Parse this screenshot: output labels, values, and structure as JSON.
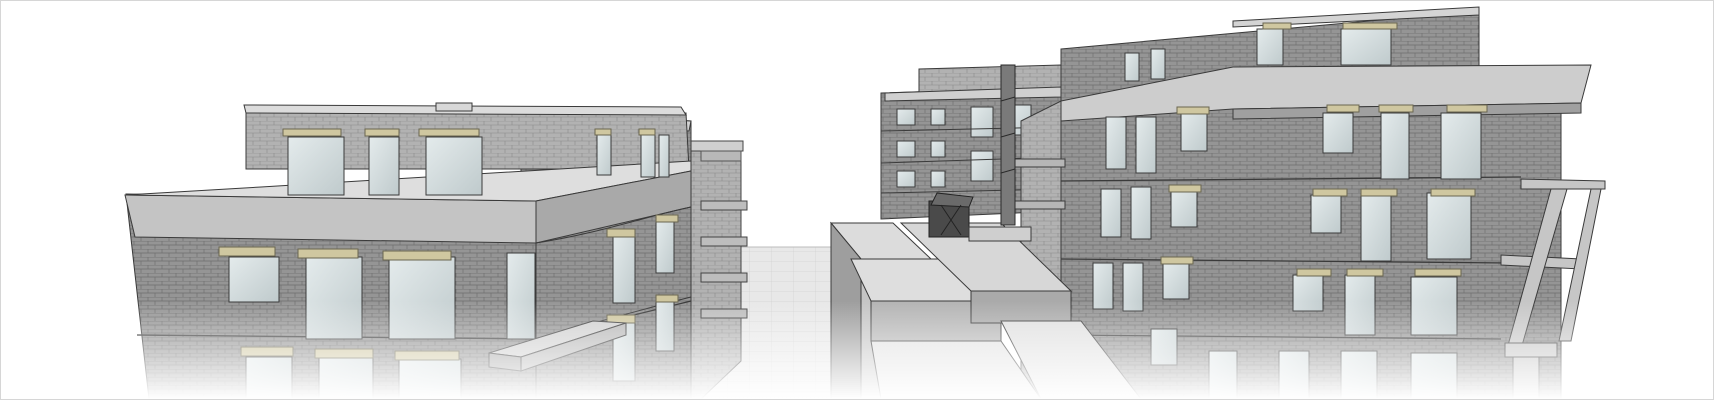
{
  "image": {
    "alt": "",
    "palette": {
      "brick": "#8f8f8f",
      "brick_light": "#a7a7a7",
      "concrete": "#c9c9c9",
      "concrete_dark": "#7d7d7d",
      "glass": "#d6dfe0",
      "lintel": "#cfc7a0",
      "outline": "#3a3a3a",
      "ground": "#e6e6e6"
    }
  }
}
